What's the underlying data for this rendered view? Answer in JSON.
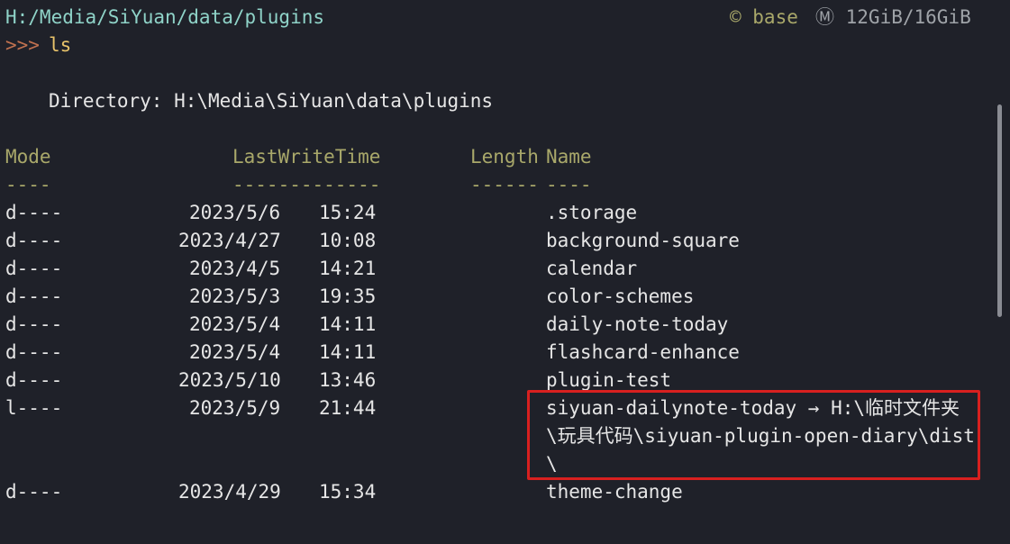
{
  "prompt": {
    "path": "H:/Media/SiYuan/data/plugins",
    "arrows": ">>>",
    "command": "ls",
    "env": "© base",
    "memory": "Ⓜ 12GiB/16GiB"
  },
  "directory_line": "Directory: H:\\Media\\SiYuan\\data\\plugins",
  "table": {
    "headers": {
      "mode": "Mode",
      "lastwritetime": "LastWriteTime",
      "length": "Length",
      "name": "Name"
    },
    "underlines": {
      "mode": "----",
      "lastwritetime": "-------------",
      "length": "------",
      "name": "----"
    },
    "rows": [
      {
        "mode": "d----",
        "date": "2023/5/6",
        "time": "15:24",
        "name": ".storage"
      },
      {
        "mode": "d----",
        "date": "2023/4/27",
        "time": "10:08",
        "name": "background-square"
      },
      {
        "mode": "d----",
        "date": "2023/4/5",
        "time": "14:21",
        "name": "calendar"
      },
      {
        "mode": "d----",
        "date": "2023/5/3",
        "time": "19:35",
        "name": "color-schemes"
      },
      {
        "mode": "d----",
        "date": "2023/5/4",
        "time": "14:11",
        "name": "daily-note-today"
      },
      {
        "mode": "d----",
        "date": "2023/5/4",
        "time": "14:11",
        "name": "flashcard-enhance"
      },
      {
        "mode": "d----",
        "date": "2023/5/10",
        "time": "13:46",
        "name": "plugin-test"
      },
      {
        "mode": "l----",
        "date": "2023/5/9",
        "time": "21:44",
        "name": "siyuan-dailynote-today → H:\\临时文件夹",
        "name2": "\\玩具代码\\siyuan-plugin-open-diary\\dist",
        "name3": "\\"
      },
      {
        "mode": "d----",
        "date": "2023/4/29",
        "time": "15:34",
        "name": "theme-change"
      }
    ]
  }
}
